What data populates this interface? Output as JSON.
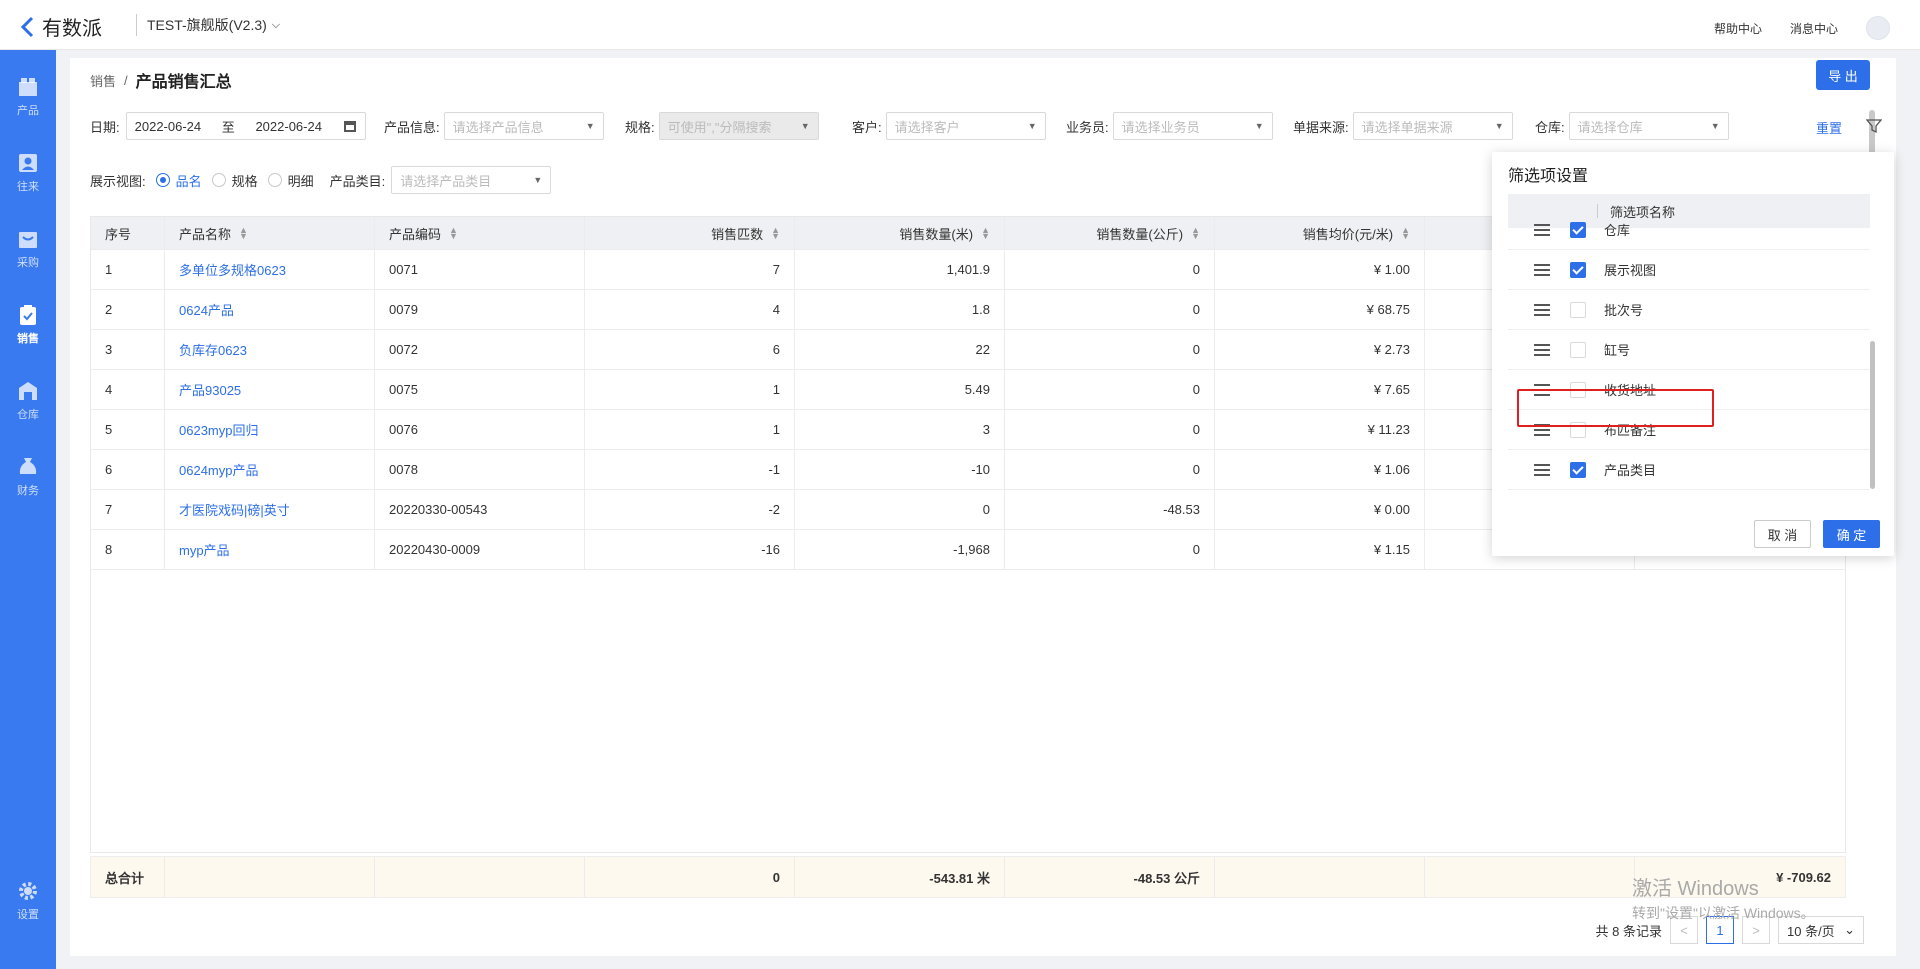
{
  "app": {
    "logo_text": "有数派",
    "version_label": "TEST-旗舰版(V2.3)"
  },
  "top": {
    "help": "帮助中心",
    "messages": "消息中心"
  },
  "sidebar": {
    "items": [
      {
        "label": "产品",
        "icon": "box-icon"
      },
      {
        "label": "往来",
        "icon": "contact-card-icon"
      },
      {
        "label": "采购",
        "icon": "cart-box-icon"
      },
      {
        "label": "销售",
        "icon": "clipboard-check-icon",
        "active": true
      },
      {
        "label": "仓库",
        "icon": "warehouse-icon"
      },
      {
        "label": "财务",
        "icon": "money-bag-icon"
      }
    ],
    "settings_label": "设置"
  },
  "breadcrumb": {
    "parent": "销售",
    "sep": "/",
    "current": "产品销售汇总"
  },
  "actions": {
    "export": "导 出",
    "reset": "重置"
  },
  "filters": {
    "date_label": "日期:",
    "date_start": "2022-06-24",
    "date_sep": "至",
    "date_end": "2022-06-24",
    "product_label": "产品信息:",
    "product_placeholder": "请选择产品信息",
    "spec_label": "规格:",
    "spec_placeholder": "可使用\",\"分隔搜索",
    "customer_label": "客户:",
    "customer_placeholder": "请选择客户",
    "salesman_label": "业务员:",
    "salesman_placeholder": "请选择业务员",
    "source_label": "单据来源:",
    "source_placeholder": "请选择单据来源",
    "warehouse_label": "仓库:",
    "warehouse_placeholder": "请选择仓库",
    "view_label": "展示视图:",
    "view_options": [
      "品名",
      "规格",
      "明细"
    ],
    "view_selected": "品名",
    "category_label": "产品类目:",
    "category_placeholder": "请选择产品类目"
  },
  "table": {
    "headers": [
      "序号",
      "产品名称",
      "产品编码",
      "销售匹数",
      "销售数量(米)",
      "销售数量(公斤)",
      "销售均价(元/米)"
    ],
    "rows": [
      [
        "1",
        "多单位多规格0623",
        "0071",
        "7",
        "1,401.9",
        "0",
        "¥ 1.00"
      ],
      [
        "2",
        "0624产品",
        "0079",
        "4",
        "1.8",
        "0",
        "¥ 68.75"
      ],
      [
        "3",
        "负库存0623",
        "0072",
        "6",
        "22",
        "0",
        "¥ 2.73"
      ],
      [
        "4",
        "产品93025",
        "0075",
        "1",
        "5.49",
        "0",
        "¥ 7.65"
      ],
      [
        "5",
        "0623myp回归",
        "0076",
        "1",
        "3",
        "0",
        "¥ 11.23"
      ],
      [
        "6",
        "0624myp产品",
        "0078",
        "-1",
        "-10",
        "0",
        "¥ 1.06"
      ],
      [
        "7",
        "才医院戏码|磅|英寸",
        "20220330-00543",
        "-2",
        "0",
        "-48.53",
        "¥ 0.00"
      ],
      [
        "8",
        "myp产品",
        "20220430-0009",
        "-16",
        "-1,968",
        "0",
        "¥ 1.15"
      ]
    ],
    "footer": {
      "label": "总合计",
      "pieces": "0",
      "meters": "-543.81 米",
      "kg": "-48.53 公斤",
      "amount": "¥ -709.62"
    }
  },
  "pagination": {
    "total": "共 8 条记录",
    "page": "1",
    "size": "10 条/页"
  },
  "watermark": {
    "line1": "激活 Windows",
    "line2": "转到\"设置\"以激活 Windows。"
  },
  "popover": {
    "title": "筛选项设置",
    "column_header": "筛选项名称",
    "items": [
      {
        "label": "仓库",
        "checked": true
      },
      {
        "label": "展示视图",
        "checked": true
      },
      {
        "label": "批次号",
        "checked": false
      },
      {
        "label": "缸号",
        "checked": false
      },
      {
        "label": "收货地址",
        "checked": false
      },
      {
        "label": "布匹备注",
        "checked": false
      },
      {
        "label": "产品类目",
        "checked": true
      }
    ],
    "cancel": "取 消",
    "ok": "确 定"
  },
  "colors": {
    "primary": "#2c6fe8",
    "sidebar": "#3a7af0",
    "highlight": "#e02020"
  }
}
